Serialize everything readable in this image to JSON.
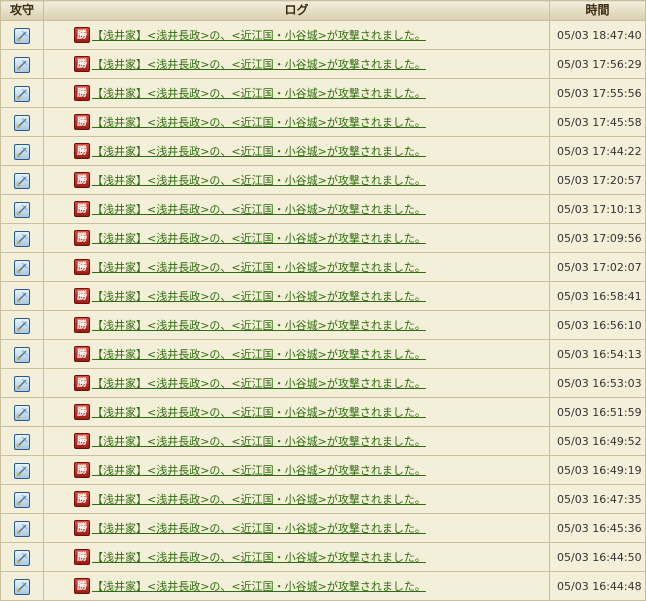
{
  "headers": {
    "attack_defense": "攻守",
    "log": "ログ",
    "time": "時間"
  },
  "icons": {
    "row_icon": "sword-attack-icon",
    "result_badge": "win-badge"
  },
  "badge_text": "勝",
  "rows": [
    {
      "message": "【浅井家】<浅井長政>の、<近江国・小谷城>が攻撃されました。",
      "time": "05/03 18:47:40"
    },
    {
      "message": "【浅井家】<浅井長政>の、<近江国・小谷城>が攻撃されました。",
      "time": "05/03 17:56:29"
    },
    {
      "message": "【浅井家】<浅井長政>の、<近江国・小谷城>が攻撃されました。",
      "time": "05/03 17:55:56"
    },
    {
      "message": "【浅井家】<浅井長政>の、<近江国・小谷城>が攻撃されました。",
      "time": "05/03 17:45:58"
    },
    {
      "message": "【浅井家】<浅井長政>の、<近江国・小谷城>が攻撃されました。",
      "time": "05/03 17:44:22"
    },
    {
      "message": "【浅井家】<浅井長政>の、<近江国・小谷城>が攻撃されました。",
      "time": "05/03 17:20:57"
    },
    {
      "message": "【浅井家】<浅井長政>の、<近江国・小谷城>が攻撃されました。",
      "time": "05/03 17:10:13"
    },
    {
      "message": "【浅井家】<浅井長政>の、<近江国・小谷城>が攻撃されました。",
      "time": "05/03 17:09:56"
    },
    {
      "message": "【浅井家】<浅井長政>の、<近江国・小谷城>が攻撃されました。",
      "time": "05/03 17:02:07"
    },
    {
      "message": "【浅井家】<浅井長政>の、<近江国・小谷城>が攻撃されました。",
      "time": "05/03 16:58:41"
    },
    {
      "message": "【浅井家】<浅井長政>の、<近江国・小谷城>が攻撃されました。",
      "time": "05/03 16:56:10"
    },
    {
      "message": "【浅井家】<浅井長政>の、<近江国・小谷城>が攻撃されました。",
      "time": "05/03 16:54:13"
    },
    {
      "message": "【浅井家】<浅井長政>の、<近江国・小谷城>が攻撃されました。",
      "time": "05/03 16:53:03"
    },
    {
      "message": "【浅井家】<浅井長政>の、<近江国・小谷城>が攻撃されました。",
      "time": "05/03 16:51:59"
    },
    {
      "message": "【浅井家】<浅井長政>の、<近江国・小谷城>が攻撃されました。",
      "time": "05/03 16:49:52"
    },
    {
      "message": "【浅井家】<浅井長政>の、<近江国・小谷城>が攻撃されました。",
      "time": "05/03 16:49:19"
    },
    {
      "message": "【浅井家】<浅井長政>の、<近江国・小谷城>が攻撃されました。",
      "time": "05/03 16:47:35"
    },
    {
      "message": "【浅井家】<浅井長政>の、<近江国・小谷城>が攻撃されました。",
      "time": "05/03 16:45:36"
    },
    {
      "message": "【浅井家】<浅井長政>の、<近江国・小谷城>が攻撃されました。",
      "time": "05/03 16:44:50"
    },
    {
      "message": "【浅井家】<浅井長政>の、<近江国・小谷城>が攻撃されました。",
      "time": "05/03 16:44:48"
    }
  ]
}
